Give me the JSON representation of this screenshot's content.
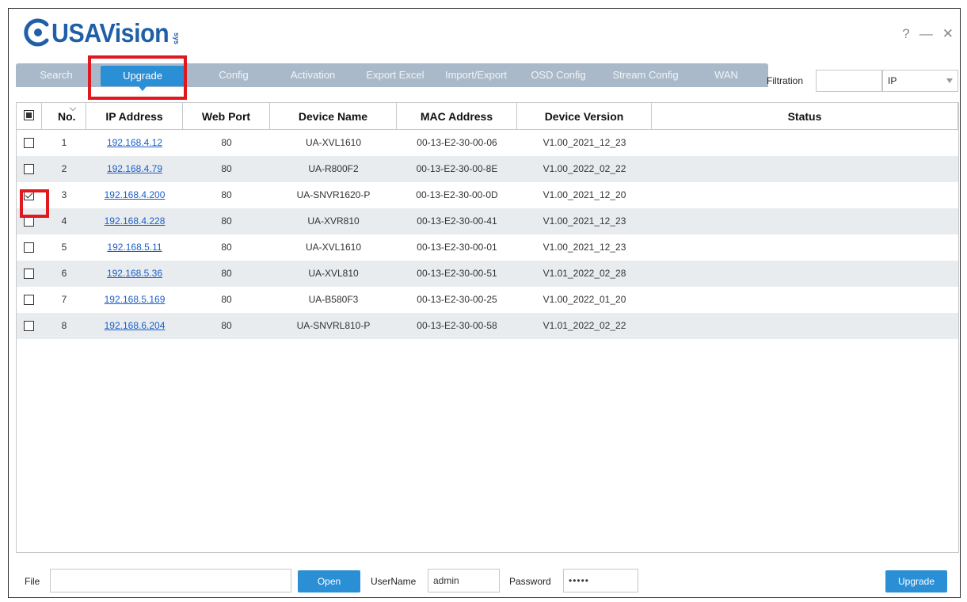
{
  "app": {
    "brand": "USAVision",
    "brand_sub": "sys",
    "window_controls": {
      "help": "?",
      "minimize": "—",
      "close": "✕"
    }
  },
  "tabs": [
    {
      "label": "Search"
    },
    {
      "label": "Upgrade",
      "active": true
    },
    {
      "label": "Config"
    },
    {
      "label": "Activation"
    },
    {
      "label": "Export Excel"
    },
    {
      "label": "Import/Export"
    },
    {
      "label": "OSD Config"
    },
    {
      "label": "Stream Config"
    },
    {
      "label": "WAN"
    }
  ],
  "filtration": {
    "label": "Filtration",
    "value": "",
    "type_selected": "IP"
  },
  "table": {
    "headers": {
      "no": "No.",
      "ip": "IP Address",
      "port": "Web Port",
      "name": "Device Name",
      "mac": "MAC Address",
      "version": "Device Version",
      "status": "Status"
    },
    "rows": [
      {
        "no": "1",
        "ip": "192.168.4.12",
        "port": "80",
        "name": "UA-XVL1610",
        "mac": "00-13-E2-30-00-06",
        "version": "V1.00_2021_12_23",
        "status": "",
        "checked": false
      },
      {
        "no": "2",
        "ip": "192.168.4.79",
        "port": "80",
        "name": "UA-R800F2",
        "mac": "00-13-E2-30-00-8E",
        "version": "V1.00_2022_02_22",
        "status": "",
        "checked": false
      },
      {
        "no": "3",
        "ip": "192.168.4.200",
        "port": "80",
        "name": "UA-SNVR1620-P",
        "mac": "00-13-E2-30-00-0D",
        "version": "V1.00_2021_12_20",
        "status": "",
        "checked": true
      },
      {
        "no": "4",
        "ip": "192.168.4.228",
        "port": "80",
        "name": "UA-XVR810",
        "mac": "00-13-E2-30-00-41",
        "version": "V1.00_2021_12_23",
        "status": "",
        "checked": false
      },
      {
        "no": "5",
        "ip": "192.168.5.11",
        "port": "80",
        "name": "UA-XVL1610",
        "mac": "00-13-E2-30-00-01",
        "version": "V1.00_2021_12_23",
        "status": "",
        "checked": false
      },
      {
        "no": "6",
        "ip": "192.168.5.36",
        "port": "80",
        "name": "UA-XVL810",
        "mac": "00-13-E2-30-00-51",
        "version": "V1.01_2022_02_28",
        "status": "",
        "checked": false
      },
      {
        "no": "7",
        "ip": "192.168.5.169",
        "port": "80",
        "name": "UA-B580F3",
        "mac": "00-13-E2-30-00-25",
        "version": "V1.00_2022_01_20",
        "status": "",
        "checked": false
      },
      {
        "no": "8",
        "ip": "192.168.6.204",
        "port": "80",
        "name": "UA-SNVRL810-P",
        "mac": "00-13-E2-30-00-58",
        "version": "V1.01_2022_02_22",
        "status": "",
        "checked": false
      }
    ]
  },
  "bottom": {
    "file_label": "File",
    "file_value": "",
    "open_label": "Open",
    "username_label": "UserName",
    "username_value": "admin",
    "password_label": "Password",
    "password_value": "•••••",
    "upgrade_label": "Upgrade"
  },
  "colors": {
    "accent": "#2b8fd6",
    "tabbar": "#a9b9c9",
    "highlight": "#e0191e",
    "link": "#1a5fc8",
    "alt_row": "#e9ecef"
  }
}
